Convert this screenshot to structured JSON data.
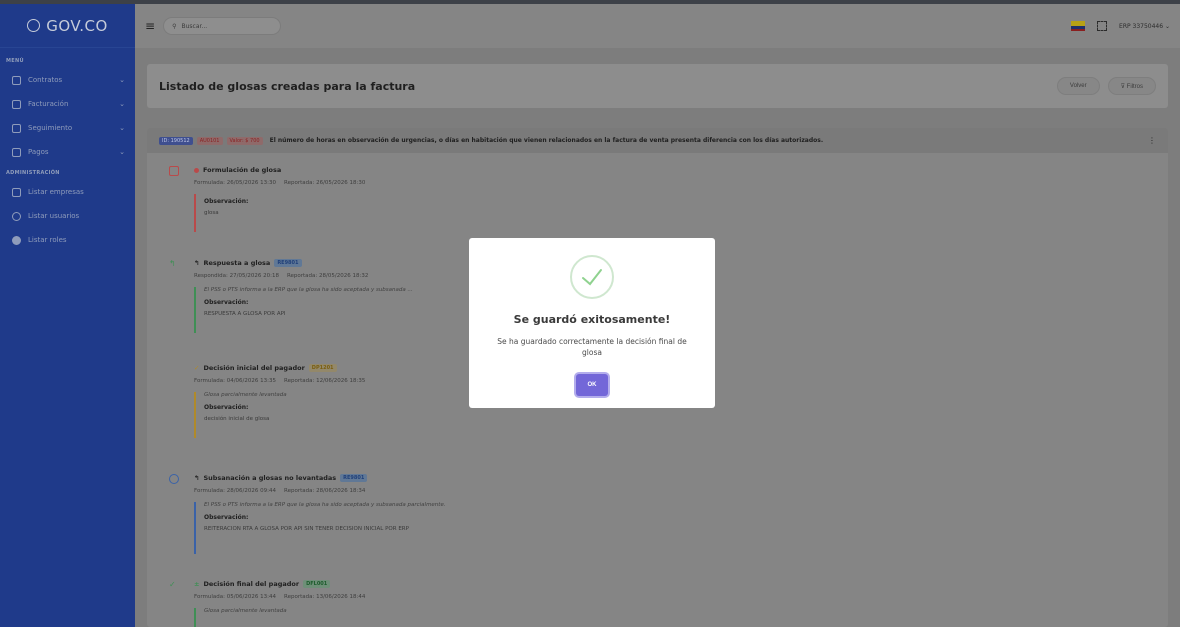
{
  "brand": {
    "logo_text": "GOV.CO"
  },
  "sidebar": {
    "menu_label": "MENÚ",
    "menu_items": [
      {
        "label": "Contratos",
        "has_submenu": true
      },
      {
        "label": "Facturación",
        "has_submenu": true
      },
      {
        "label": "Seguimiento",
        "has_submenu": true
      },
      {
        "label": "Pagos",
        "has_submenu": true
      }
    ],
    "admin_label": "ADMINISTRACIÓN",
    "admin_items": [
      {
        "label": "Listar empresas"
      },
      {
        "label": "Listar usuarios"
      },
      {
        "label": "Listar roles"
      }
    ]
  },
  "header": {
    "search_placeholder": "Buscar...",
    "user_label": "ERP 33750446 ⌄"
  },
  "page": {
    "title": "Listado de glosas creadas para la factura",
    "back_button": "Volver",
    "filter_button": "⊽ Filtros"
  },
  "glosa": {
    "id_badge": "ID: 190512",
    "code_badge": "AU0101",
    "value_badge": "Valor: $ 700",
    "description": "El número de horas en observación de urgencias, o días en habitación que vienen relacionados en la factura de venta presenta diferencia con los días autorizados.",
    "menu_icon": "⋮"
  },
  "timeline": [
    {
      "title": "Formulación de glosa",
      "badge": "",
      "meta1": "Formulada: 26/05/2026 13:30",
      "meta2": "Reportada: 26/05/2026 18:30",
      "italic": "",
      "obs_label": "Observación:",
      "obs_text": "glosa",
      "color": "#b94a4a"
    },
    {
      "title": "Respuesta a glosa",
      "badge": "RE9801",
      "meta1": "Respondida: 27/05/2026 20:18",
      "meta2": "Reportada: 28/05/2026 18:32",
      "italic": "El PSS o PTS informa a la ERP que la glosa ha sido aceptada y subsanada ...",
      "obs_label": "Observación:",
      "obs_text": "RESPUESTA A GLOSA POR API",
      "color": "#3f8f55"
    },
    {
      "title": "Decisión inicial del pagador",
      "badge": "DP1201",
      "meta1": "Formulada: 04/06/2026 13:35",
      "meta2": "Reportada: 12/06/2026 18:35",
      "italic": "Glosa parcialmente levantada",
      "obs_label": "Observación:",
      "obs_text": "decisión inicial de glosa",
      "color": "#b08a2a"
    },
    {
      "title": "Subsanación a glosas no levantadas",
      "badge": "RE9801",
      "meta1": "Formulada: 28/06/2026 09:44",
      "meta2": "Reportada: 28/06/2026 18:34",
      "italic": "El PSS o PTS informa a la ERP que la glosa ha sido aceptada y subsanada parcialmente.",
      "obs_label": "Observación:",
      "obs_text": "REITERACION RTA A GLOSA POR API SIN TENER DECISION INICIAL POR ERP",
      "color": "#3a62a8"
    },
    {
      "title": "Decisión final del pagador",
      "badge": "DFL001",
      "meta1": "Formulada: 05/06/2026 13:44",
      "meta2": "Reportada: 13/06/2026 18:44",
      "italic": "Glosa parcialmente levantada",
      "obs_label": "",
      "obs_text": "",
      "color": "#3f8f55"
    }
  ],
  "modal": {
    "title": "Se guardó exitosamente!",
    "message": "Se ha guardado correctamente la decisión final de glosa",
    "ok_label": "OK"
  }
}
